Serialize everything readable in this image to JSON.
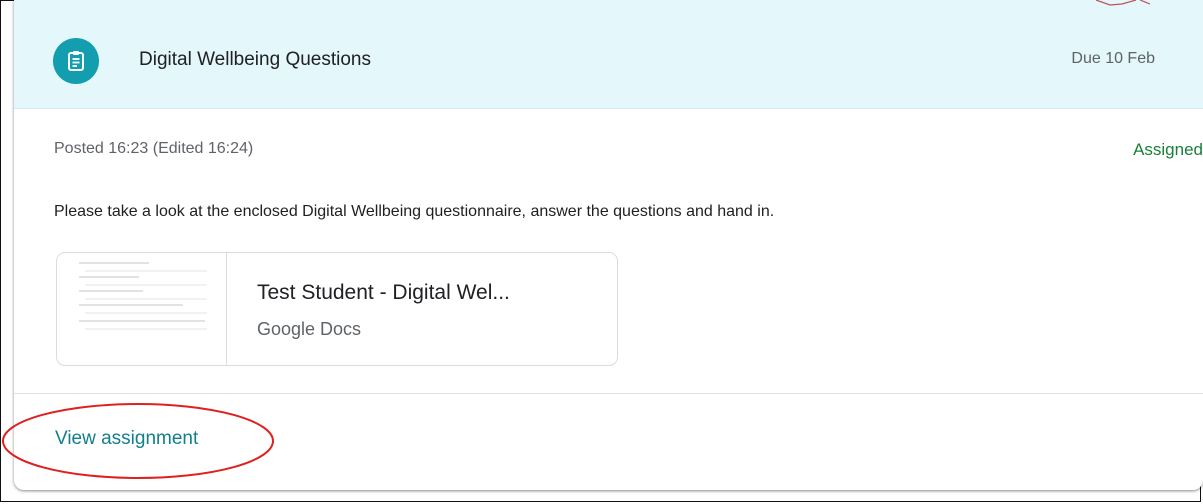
{
  "assignment": {
    "title": "Digital Wellbeing Questions",
    "due": "Due 10 Feb",
    "posted": "Posted 16:23 (Edited 16:24)",
    "status": "Assigned",
    "description": "Please take a look at the enclosed Digital Wellbeing questionnaire, answer the questions and hand in.",
    "icon": "assignment-clipboard-icon",
    "accent_color": "#129eaf",
    "header_bg": "#e4f7fb",
    "status_color": "#188038"
  },
  "attachment": {
    "title": "Test Student - Digital Wel...",
    "type": "Google Docs"
  },
  "footer": {
    "view_label": "View assignment",
    "link_color": "#137e8c",
    "annotation_color": "#e02020"
  }
}
